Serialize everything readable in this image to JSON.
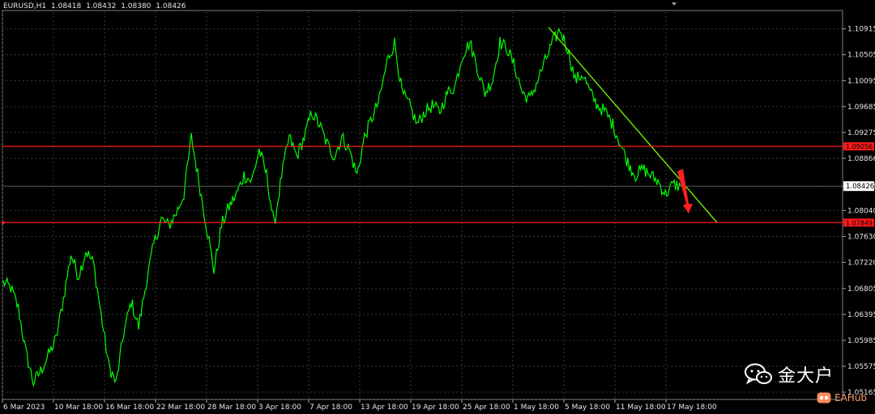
{
  "header": {
    "symbol_timeframe": "EURUSD,H1",
    "open": "1.08418",
    "high": "1.08432",
    "low": "1.08380",
    "close": "1.08426"
  },
  "colors": {
    "background": "#000000",
    "price_line": "#00ff00",
    "trendline": "#7cfc00",
    "level_lines": "#ff1a1a",
    "grid": "#3a3a3a",
    "axis_text": "#e6e6e6",
    "arrow": "#ff2020"
  },
  "chart_data": {
    "type": "line",
    "series": [
      {
        "values_sampled_close": [
          1.069,
          1.0682,
          1.065,
          1.058,
          1.0532,
          1.055,
          1.0575,
          1.06,
          1.0665,
          1.0735,
          1.07,
          1.074,
          1.072,
          1.064,
          1.056,
          1.053,
          1.061,
          1.066,
          1.062,
          1.069,
          1.075,
          1.079,
          1.078,
          1.08,
          1.083,
          1.092,
          1.085,
          1.078,
          1.071,
          1.078,
          1.081,
          1.083,
          1.086,
          1.085,
          1.09,
          1.086,
          1.078,
          1.086,
          1.092,
          1.089,
          1.092,
          1.096,
          1.094,
          1.091,
          1.089,
          1.092,
          1.09,
          1.086,
          1.092,
          1.095,
          1.098,
          1.104,
          1.107,
          1.099,
          1.097,
          1.094,
          1.096,
          1.097,
          1.096,
          1.099,
          1.1,
          1.105,
          1.107,
          1.103,
          1.099,
          1.101,
          1.107,
          1.106,
          1.103,
          1.099,
          1.098,
          1.101,
          1.104,
          1.107,
          1.109,
          1.106,
          1.101,
          1.102,
          1.099,
          1.097,
          1.096,
          1.094,
          1.091,
          1.088,
          1.086,
          1.087,
          1.086,
          1.085,
          1.083,
          1.0845,
          1.0843
        ]
      }
    ],
    "ylim": [
      1.0505,
      1.1118
    ],
    "y_ticks": [
      "1.10915",
      "1.10505",
      "1.10095",
      "1.09685",
      "1.09275",
      "1.08866",
      "1.08426",
      "1.08040",
      "1.07630",
      "1.07220",
      "1.06805",
      "1.06395",
      "1.05985",
      "1.05575",
      "1.05165"
    ],
    "x_ticks": [
      "6 Mar 2023",
      "10 Mar 18:00",
      "16 Mar 18:00",
      "22 Mar 18:00",
      "28 Mar 18:00",
      "3 Apr 18:00",
      "7 Apr 18:00",
      "13 Apr 18:00",
      "19 Apr 18:00",
      "25 Apr 18:00",
      "1 May 18:00",
      "5 May 18:00",
      "11 May 18:00",
      "17 May 18:00"
    ],
    "horizontal_levels": [
      {
        "value": 1.09056,
        "label": "1.09056"
      },
      {
        "value": 1.07849,
        "label": "1.07849"
      }
    ],
    "current_price": {
      "value": 1.08426,
      "label": "1.08426"
    },
    "trendline": {
      "from": [
        1.1094
      ],
      "to": [
        1.0785
      ]
    },
    "grid": true
  },
  "watermark": {
    "text": "金大户",
    "icon": "wechat-icon"
  },
  "badge": {
    "text": "EAHub",
    "icon": "eahub-logo-icon"
  }
}
